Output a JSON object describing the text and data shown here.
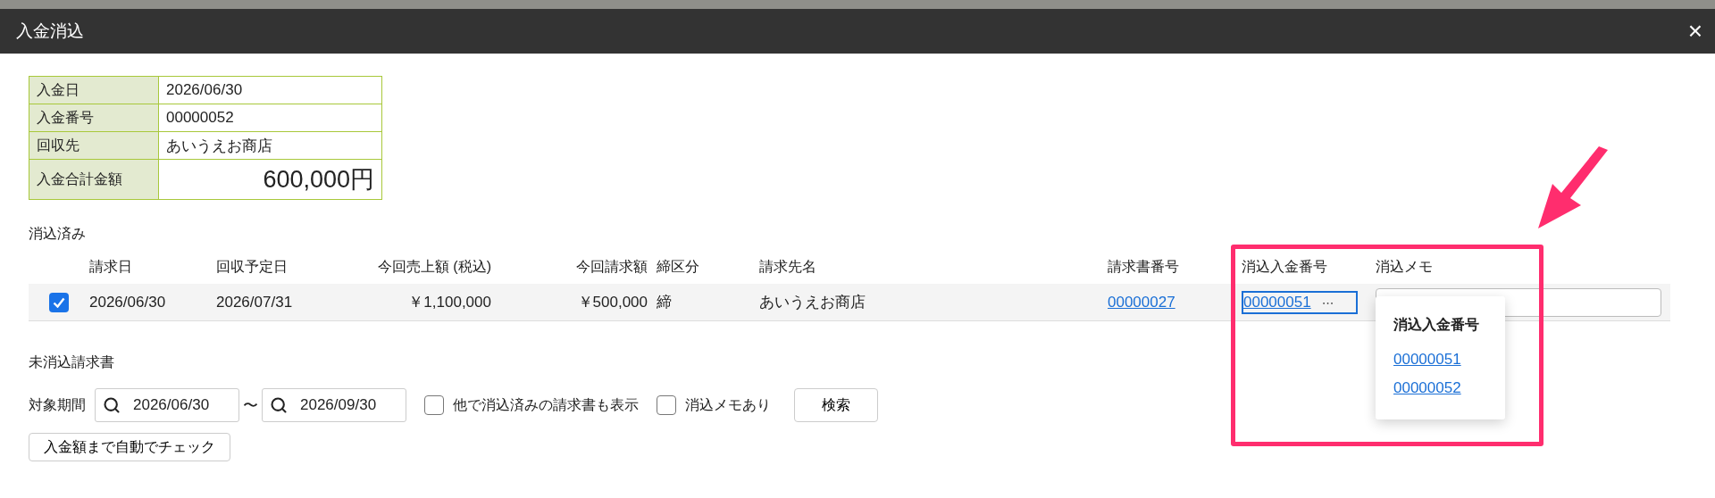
{
  "dialog": {
    "title": "入金消込",
    "close": "×"
  },
  "summary": [
    {
      "label": "入金日",
      "value": "2026/06/30",
      "kind": "text"
    },
    {
      "label": "入金番号",
      "value": "00000052",
      "kind": "text"
    },
    {
      "label": "回収先",
      "value": "あいうえお商店",
      "kind": "text"
    },
    {
      "label": "入金合計金額",
      "value": "600,000円",
      "kind": "total"
    }
  ],
  "reconciled": {
    "heading": "消込済み",
    "columns": [
      {
        "label": "請求日",
        "kind": "text"
      },
      {
        "label": "回収予定日",
        "kind": "text"
      },
      {
        "label": "今回売上額 (税込)",
        "kind": "amount"
      },
      {
        "label": "今回請求額",
        "kind": "amount"
      },
      {
        "label": "締区分",
        "kind": "text"
      },
      {
        "label": "請求先名",
        "kind": "text"
      },
      {
        "label": "請求書番号",
        "kind": "text"
      },
      {
        "label": "消込入金番号",
        "kind": "text"
      },
      {
        "label": "消込メモ",
        "kind": "text"
      }
    ],
    "rows": [
      {
        "checked": true,
        "cells": [
          "2026/06/30",
          "2026/07/31",
          "￥1,100,000",
          "￥500,000",
          "締",
          "あいうえお商店"
        ],
        "invoice_no": "00000027",
        "payment_no": "00000051",
        "more": "⋯"
      }
    ]
  },
  "popup": {
    "title": "消込入金番号",
    "links": [
      "00000051",
      "00000052"
    ]
  },
  "unreconciled": {
    "heading": "未消込請求書",
    "period_label": "対象期間",
    "from": "2026/06/30",
    "tilde": "〜",
    "to": "2026/09/30",
    "checkboxes": [
      {
        "label": "他で消込済みの請求書も表示",
        "checked": false
      },
      {
        "label": "消込メモあり",
        "checked": false
      }
    ],
    "search_button": "検索",
    "auto_check_button": "入金額まで自動でチェック"
  }
}
